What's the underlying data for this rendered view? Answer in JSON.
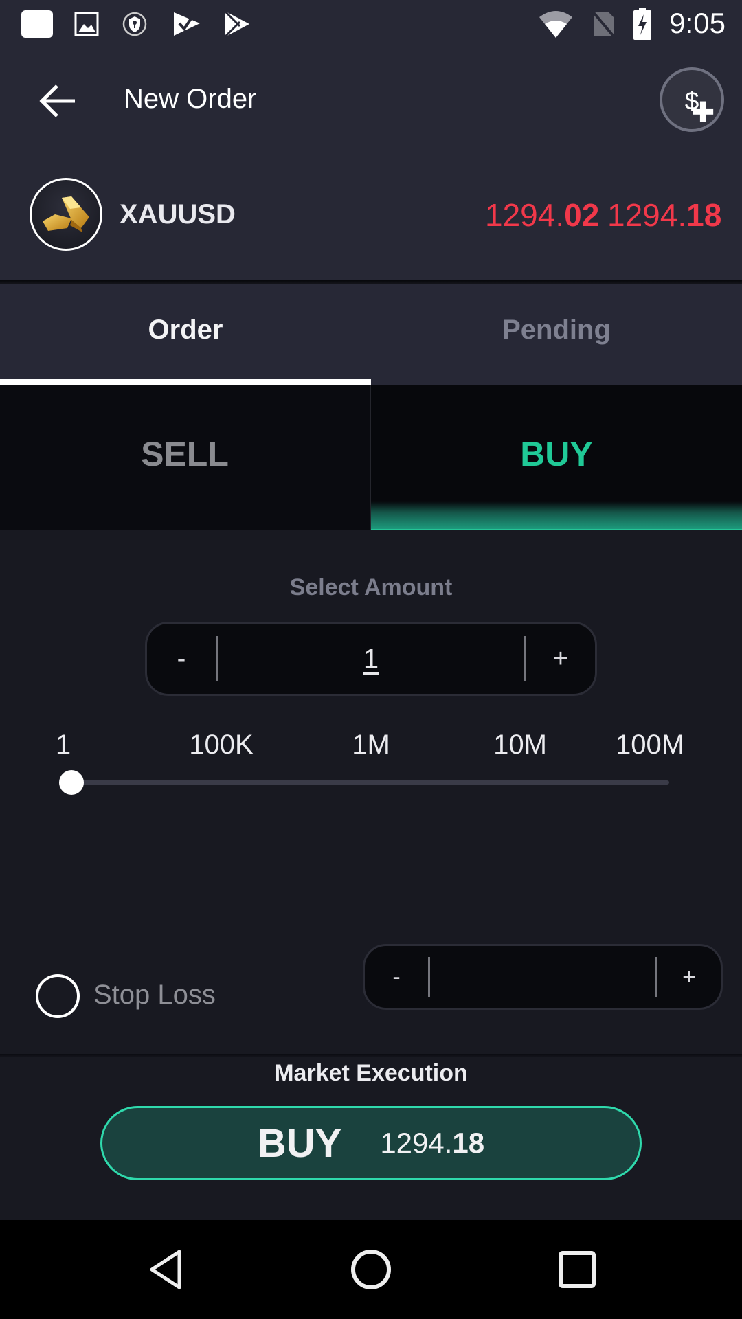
{
  "status_bar": {
    "time": "9:05",
    "left_icons": [
      "notification-icon",
      "gallery-icon",
      "vpn-shield-icon",
      "task-check-icon",
      "play-store-icon"
    ],
    "right_icons": [
      "wifi-icon",
      "no-sim-icon",
      "battery-charging-icon"
    ]
  },
  "app_bar": {
    "title": "New Order",
    "back_icon": "arrow-left-icon",
    "action_icon": "add-funds-icon"
  },
  "instrument": {
    "symbol": "XAUUSD",
    "icon": "gold-bars-icon",
    "bid": {
      "main": "1294.",
      "pips": "02"
    },
    "ask": {
      "main": "1294.",
      "pips": "18"
    },
    "price_color": "#f1384a"
  },
  "tabs": [
    {
      "label": "Order",
      "active": true
    },
    {
      "label": "Pending",
      "active": false
    }
  ],
  "side_toggle": {
    "sell_label": "SELL",
    "buy_label": "BUY",
    "selected": "BUY",
    "buy_color": "#20c997"
  },
  "amount": {
    "label": "Select Amount",
    "decrement": "-",
    "increment": "+",
    "value": "1"
  },
  "slider": {
    "labels": [
      "1",
      "100K",
      "1M",
      "10M",
      "100M"
    ],
    "position_fraction": 0.0
  },
  "stop_loss": {
    "label": "Stop Loss",
    "checked": false,
    "decrement": "-",
    "increment": "+",
    "value": ""
  },
  "execution": {
    "label": "Market Execution",
    "button_label": "BUY",
    "price": {
      "main": "1294.",
      "pips": "18"
    },
    "accent": "#2fd9ac"
  },
  "nav_bar": {
    "icons": [
      "nav-back-icon",
      "nav-home-icon",
      "nav-recents-icon"
    ]
  }
}
